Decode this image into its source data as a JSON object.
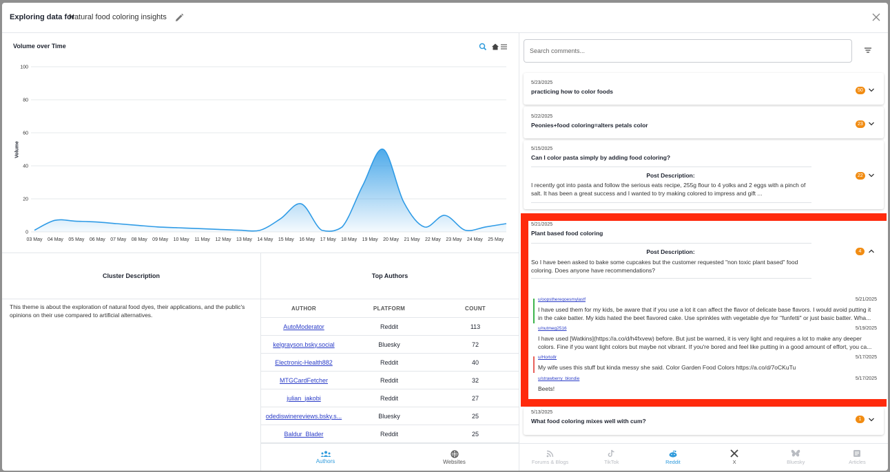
{
  "header": {
    "prefix": "Exploring data for",
    "name": "Natural food coloring insights"
  },
  "chart": {
    "title": "Volume over Time",
    "tools": [
      "zoom-icon",
      "home-icon",
      "menu-icon"
    ]
  },
  "chart_data": {
    "type": "area",
    "title": "Volume over Time",
    "xlabel": "",
    "ylabel": "Volume",
    "ylim": [
      0,
      100
    ],
    "yticks": [
      0,
      20,
      40,
      60,
      80,
      100
    ],
    "grid": true,
    "x": [
      "03 May",
      "04 May",
      "05 May",
      "06 May",
      "07 May",
      "08 May",
      "09 May",
      "10 May",
      "11 May",
      "12 May",
      "13 May",
      "14 May",
      "15 May",
      "16 May",
      "17 May",
      "18 May",
      "19 May",
      "20 May",
      "21 May",
      "22 May",
      "23 May",
      "24 May",
      "25 May"
    ],
    "values": [
      1,
      7,
      6.5,
      6,
      5,
      4,
      3,
      2.5,
      2,
      1.5,
      1,
      1,
      8,
      17,
      1,
      3,
      28,
      50,
      18,
      3,
      10,
      1,
      3,
      5
    ],
    "color": "#2f9be6"
  },
  "cluster": {
    "title": "Cluster Description",
    "body": "This theme is about the exploration of natural food dyes, their applications, and the public's opinions on their use compared to artificial alternatives."
  },
  "authors": {
    "title": "Top Authors",
    "columns": [
      "AUTHOR",
      "PLATFORM",
      "COUNT"
    ],
    "rows": [
      {
        "author": "AutoModerator",
        "platform": "Reddit",
        "count": "113"
      },
      {
        "author": "kelgrayson.bsky.social",
        "platform": "Bluesky",
        "count": "72"
      },
      {
        "author": "Electronic-Health882",
        "platform": "Reddit",
        "count": "40"
      },
      {
        "author": "MTGCardFetcher",
        "platform": "Reddit",
        "count": "32"
      },
      {
        "author": "julian_jakobi",
        "platform": "Reddit",
        "count": "27"
      },
      {
        "author": "odediswinereviews.bsky.s...",
        "platform": "Bluesky",
        "count": "25"
      },
      {
        "author": "Baldur_Blader",
        "platform": "Reddit",
        "count": "25"
      }
    ]
  },
  "left_tabs": [
    {
      "label": "Authors",
      "icon": "people-icon",
      "active": true
    },
    {
      "label": "Websites",
      "icon": "globe-icon",
      "active": false
    }
  ],
  "search": {
    "placeholder": "Search comments..."
  },
  "posts": [
    {
      "date": "5/23/2025",
      "title": "practicing how to color foods",
      "count": "50"
    },
    {
      "date": "5/22/2025",
      "title": "Peonies+food coloring=alters petals color",
      "count": "23"
    },
    {
      "date": "5/15/2025",
      "title": "Can I color pasta simply by adding food coloring?",
      "count": "22",
      "desc_label": "Post Description:",
      "desc": "I recently got into pasta and follow the serious eats recipe, 255g flour to 4 yolks and 2 eggs with a pinch of salt. It has been a great success and I wanted to try making colored to impress and gift ..."
    },
    {
      "date": "5/21/2025",
      "title": "Plant based food coloring",
      "count": "4",
      "desc_label": "Post Description:",
      "desc": "So I have been asked to bake some cupcakes but the customer requested \"non toxic plant based\" food coloring. Does anyone have recommendations?"
    },
    {
      "date": "5/13/2025",
      "title": "What food coloring mixes well with cum?",
      "count": "1"
    }
  ],
  "comments": [
    {
      "user": "u/oopsthereqoesmylastf",
      "date": "5/21/2025",
      "color": "#3cb44b",
      "text": "I have used them for my kids, be aware that if you use a lot it can affect the flavor of delicate base flavors. I would avoid putting it in the cake batter. My kids hated the beet flavored cake. Use sprinkles with vegetable dye for \"funfetti\" or just basic batter. Wha..."
    },
    {
      "user": "u/nutmeg2516",
      "date": "5/19/2025",
      "color": "#ffffff",
      "text": "I have used [Watkins](https://a.co/d/h4fxvew) before. But just be warned, it is very light and requires a lot to make any deeper colors. Fine if you want light colors but maybe not vibrant. If you're bored and feel like putting in a good amount of effort, you ca..."
    },
    {
      "user": "u/Horto8r",
      "date": "5/17/2025",
      "color": "#e8605a",
      "text": "My wife uses this stuff but kinda messy she said. Color Garden Food Colors https://a.co/d/7oCKuTu"
    },
    {
      "user": "u/strawberry_blondie",
      "date": "5/17/2025",
      "color": "#ffffff",
      "text": "Beets!"
    }
  ],
  "right_tabs": [
    {
      "label": "Forums & Blogs",
      "icon": "rss-icon",
      "state": "disabled"
    },
    {
      "label": "TikTok",
      "icon": "tiktok-icon",
      "state": "disabled"
    },
    {
      "label": "Reddit",
      "icon": "reddit-icon",
      "state": "active"
    },
    {
      "label": "X",
      "icon": "x-icon",
      "state": "normal"
    },
    {
      "label": "Bluesky",
      "icon": "bluesky-icon",
      "state": "disabled"
    },
    {
      "label": "Articles",
      "icon": "article-icon",
      "state": "disabled"
    }
  ]
}
